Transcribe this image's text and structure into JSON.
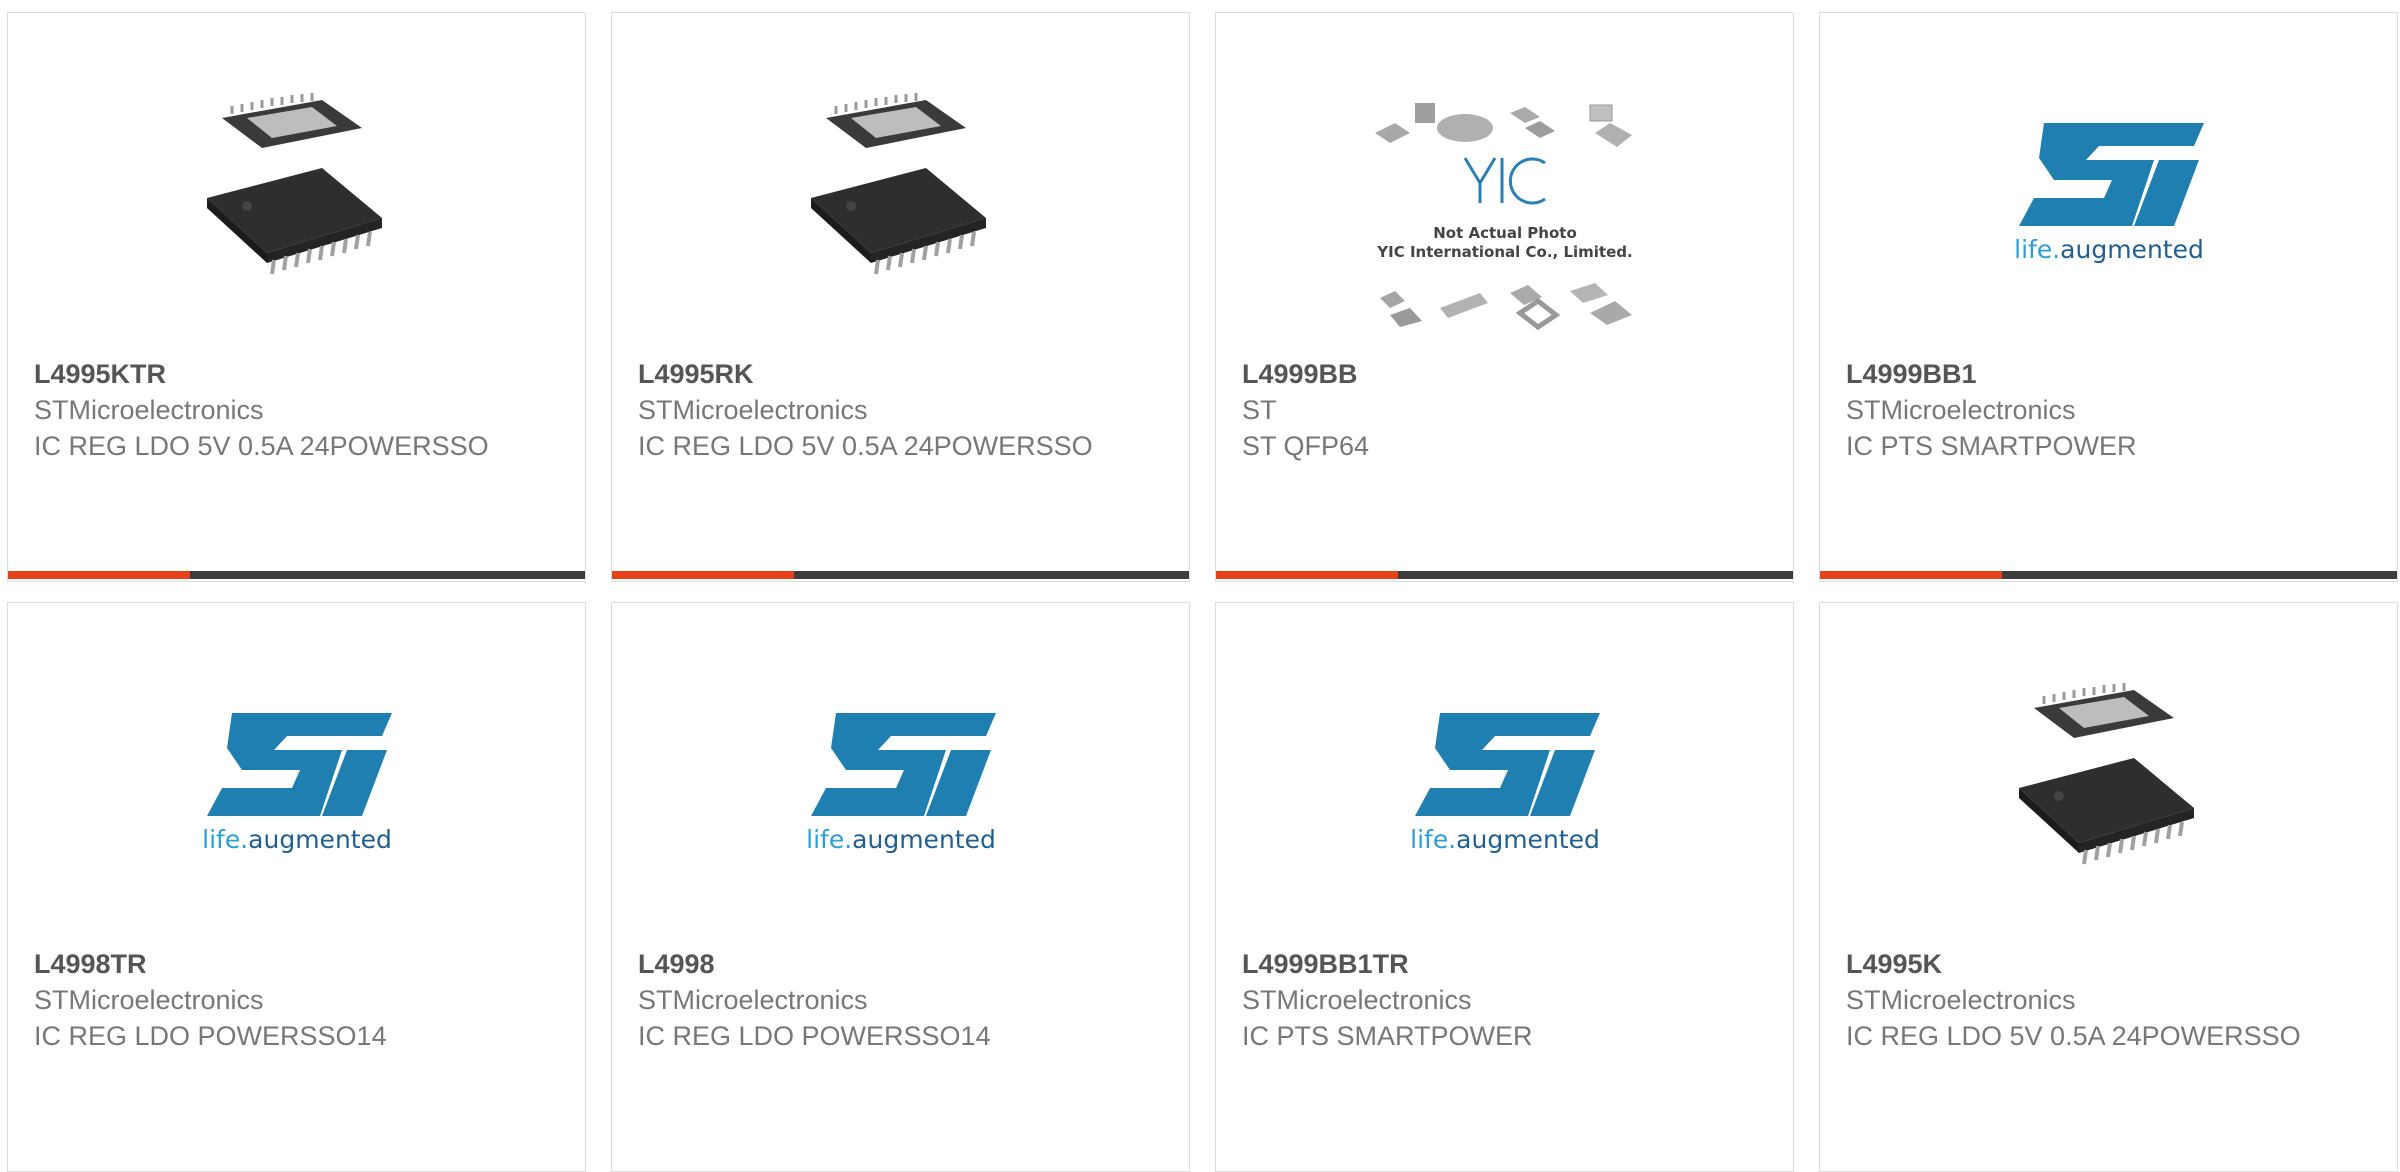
{
  "products": [
    {
      "part_number": "L4995KTR",
      "manufacturer": "STMicroelectronics",
      "description": "IC REG LDO 5V 0.5A 24POWERSSO",
      "image": "chip-package-icon"
    },
    {
      "part_number": "L4995RK",
      "manufacturer": "STMicroelectronics",
      "description": "IC REG LDO 5V 0.5A 24POWERSSO",
      "image": "chip-package-icon"
    },
    {
      "part_number": "L4999BB",
      "manufacturer": "ST",
      "description": "ST QFP64",
      "image": "yic-not-actual-photo-icon",
      "image_text": {
        "brand": "YIC",
        "line1": "Not Actual Photo",
        "line2": "YIC International Co., Limited."
      }
    },
    {
      "part_number": "L4999BB1",
      "manufacturer": "STMicroelectronics",
      "description": "IC PTS SMARTPOWER",
      "image": "st-logo-icon"
    },
    {
      "part_number": "L4998TR",
      "manufacturer": "STMicroelectronics",
      "description": "IC REG LDO POWERSSO14",
      "image": "st-logo-icon"
    },
    {
      "part_number": "L4998",
      "manufacturer": "STMicroelectronics",
      "description": "IC REG LDO POWERSSO14",
      "image": "st-logo-icon"
    },
    {
      "part_number": "L4999BB1TR",
      "manufacturer": "STMicroelectronics",
      "description": "IC PTS SMARTPOWER",
      "image": "st-logo-icon"
    },
    {
      "part_number": "L4995K",
      "manufacturer": "STMicroelectronics",
      "description": "IC REG LDO 5V 0.5A 24POWERSSO",
      "image": "chip-package-icon"
    }
  ],
  "st_logo": {
    "tagline_prefix": "life.",
    "tagline_suffix": "augmented"
  },
  "colors": {
    "accent": "#e8421b",
    "bar_dark": "#3d3d3d",
    "st_blue": "#1e7fb0",
    "tagline_blue": "#2a7fb5",
    "text_bold": "#555555",
    "text_light": "#777777"
  }
}
